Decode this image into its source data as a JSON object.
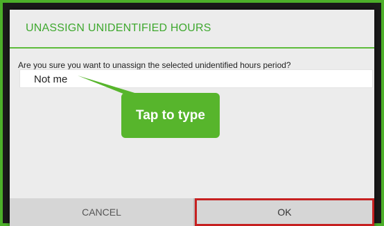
{
  "dialog": {
    "title": "UNASSIGN UNIDENTIFIED HOURS",
    "message": "Are you sure you want to unassign the selected unidentified hours period?",
    "input_value": "Not me",
    "callout_text": "Tap to type",
    "cancel_label": "CANCEL",
    "ok_label": "OK"
  },
  "colors": {
    "accent_green": "#4caf2a",
    "ok_highlight": "#c62020"
  }
}
